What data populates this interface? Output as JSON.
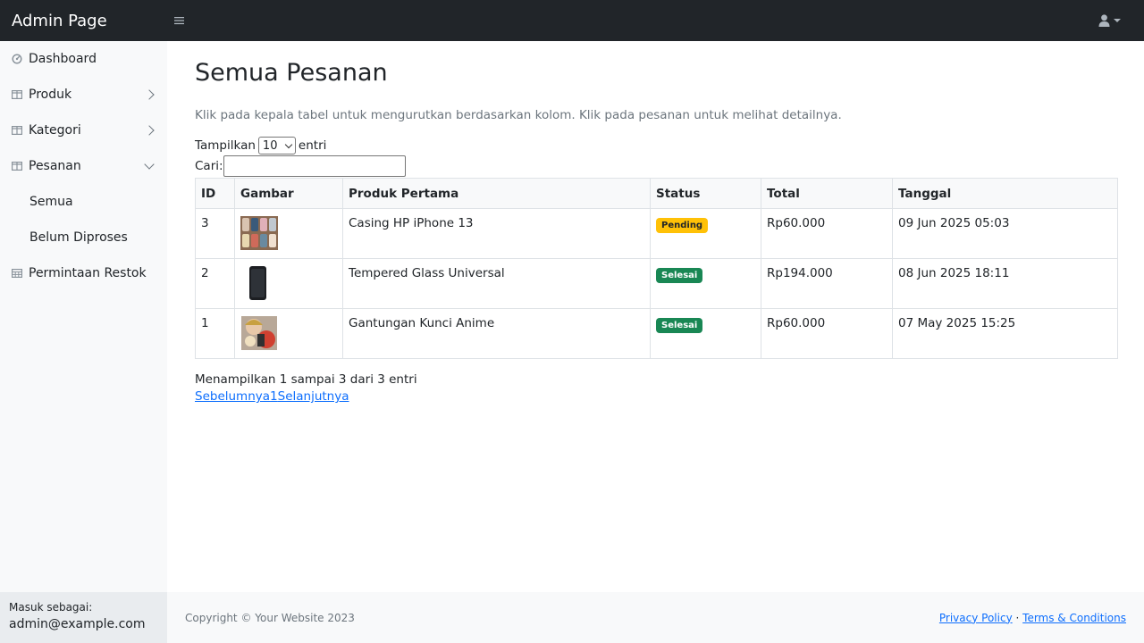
{
  "navbar": {
    "brand": "Admin Page",
    "toggle_icon": "bars-icon",
    "user_icon": "user-icon"
  },
  "sidebar": {
    "items": [
      {
        "label": "Dashboard",
        "icon": "tachometer-icon"
      },
      {
        "label": "Produk",
        "icon": "columns-icon",
        "expandable": true,
        "expanded": false
      },
      {
        "label": "Kategori",
        "icon": "columns-icon",
        "expandable": true,
        "expanded": false
      },
      {
        "label": "Pesanan",
        "icon": "columns-icon",
        "expandable": true,
        "expanded": true,
        "children": [
          {
            "label": "Semua"
          },
          {
            "label": "Belum Diproses"
          }
        ]
      },
      {
        "label": "Permintaan Restok",
        "icon": "table-icon"
      }
    ],
    "footer": {
      "label": "Masuk sebagai:",
      "user": "admin@example.com"
    }
  },
  "main": {
    "title": "Semua Pesanan",
    "description": "Klik pada kepala tabel untuk mengurutkan berdasarkan kolom. Klik pada pesanan untuk melihat detailnya.",
    "length": {
      "prefix": "Tampilkan",
      "value": "10",
      "suffix": "entri"
    },
    "search": {
      "label": "Cari:",
      "value": ""
    },
    "table": {
      "headers": [
        "ID",
        "Gambar",
        "Produk Pertama",
        "Status",
        "Total",
        "Tanggal"
      ],
      "rows": [
        {
          "id": "3",
          "image": "phone-cases-thumbnail",
          "product": "Casing HP iPhone 13",
          "status": "Pending",
          "total": "Rp60.000",
          "date": "09 Jun 2025 05:03"
        },
        {
          "id": "2",
          "image": "tempered-glass-thumbnail",
          "product": "Tempered Glass Universal",
          "status": "Selesai",
          "total": "Rp194.000",
          "date": "08 Jun 2025 18:11"
        },
        {
          "id": "1",
          "image": "anime-keychain-thumbnail",
          "product": "Gantungan Kunci Anime",
          "status": "Selesai",
          "total": "Rp60.000",
          "date": "07 May 2025 15:25"
        }
      ]
    },
    "info": "Menampilkan 1 sampai 3 dari 3 entri",
    "pager": {
      "prev": "Sebelumnya",
      "page": "1",
      "next": "Selanjutnya"
    }
  },
  "footer": {
    "copyright": "Copyright © Your Website 2023",
    "privacy": "Privacy Policy",
    "separator": "·",
    "terms": "Terms & Conditions"
  },
  "colors": {
    "navbar_bg": "#212529",
    "sidebar_bg": "#f8f9fa",
    "pending_badge": "#ffc107",
    "done_badge": "#198754",
    "link": "#0d6efd"
  }
}
